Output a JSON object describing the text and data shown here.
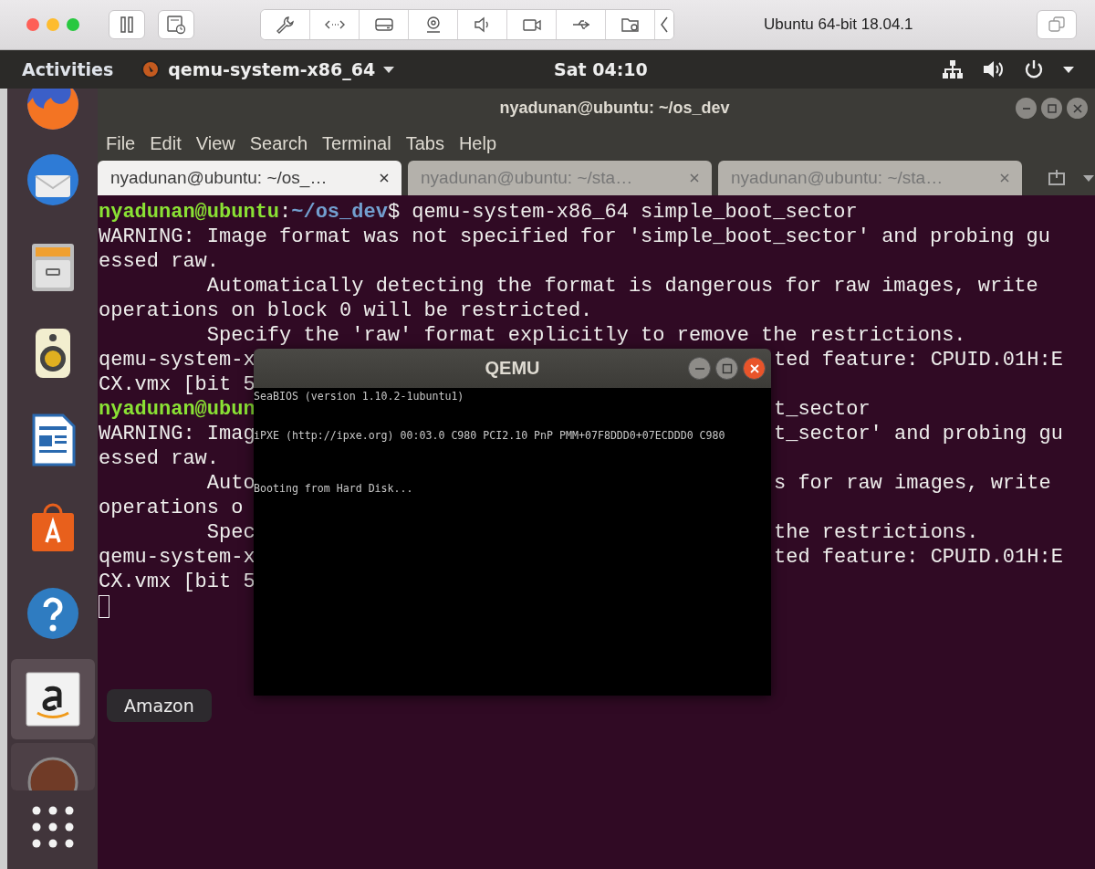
{
  "vm_toolbar": {
    "title": "Ubuntu 64-bit 18.04.1"
  },
  "top_bar": {
    "activities": "Activities",
    "app_menu": "qemu-system-x86_64",
    "clock": "Sat 04:10"
  },
  "dock": {
    "items": [
      {
        "kind": "firefox",
        "highlighted": false
      },
      {
        "kind": "mail",
        "highlighted": false
      },
      {
        "kind": "files",
        "highlighted": false
      },
      {
        "kind": "music",
        "highlighted": false
      },
      {
        "kind": "writer",
        "highlighted": false
      },
      {
        "kind": "software",
        "highlighted": false
      },
      {
        "kind": "help",
        "highlighted": false
      },
      {
        "kind": "amazon",
        "highlighted": true
      },
      {
        "kind": "qemu",
        "highlighted": false
      },
      {
        "kind": "apps",
        "highlighted": false
      }
    ],
    "tooltip": "Amazon"
  },
  "terminal": {
    "title": "nyadunan@ubuntu: ~/os_dev",
    "menu": [
      "File",
      "Edit",
      "View",
      "Search",
      "Terminal",
      "Tabs",
      "Help"
    ],
    "tabs": [
      {
        "label": "nyadunan@ubuntu: ~/os_…",
        "selected": true
      },
      {
        "label": "nyadunan@ubuntu: ~/sta…",
        "selected": false
      },
      {
        "label": "nyadunan@ubuntu: ~/sta…",
        "selected": false
      }
    ],
    "lines": [
      {
        "kind": "prompt",
        "user": "nyadunan@ubuntu",
        "colon": ":",
        "path": "~/os_dev",
        "command": "$ qemu-system-x86_64 simple_boot_sector"
      },
      {
        "kind": "text",
        "left": "WARNING: Image format was not specified for 'simple_boot_sector' and probing gu"
      },
      {
        "kind": "text",
        "left": "essed raw."
      },
      {
        "kind": "text",
        "left": "         Automatically detecting the format is dangerous for raw images, write"
      },
      {
        "kind": "text",
        "left": "operations on block 0 will be restricted."
      },
      {
        "kind": "text",
        "left": "         Specify the 'raw' format explicitly to remove the restrictions."
      },
      {
        "kind": "text",
        "left": "qemu-system-x",
        "right": "ted feature: CPUID.01H:E"
      },
      {
        "kind": "text",
        "left": "CX.vmx [bit 5"
      },
      {
        "kind": "user",
        "left": "nyadunan@ubun",
        "right": "t_sector"
      },
      {
        "kind": "text",
        "left": "WARNING: Imag",
        "right": "t_sector' and probing gu"
      },
      {
        "kind": "text",
        "left": "essed raw."
      },
      {
        "kind": "text",
        "left": "         Auto",
        "right": "s for raw images, write"
      },
      {
        "kind": "text",
        "left": "operations o"
      },
      {
        "kind": "text",
        "left": "         Spec",
        "right": "the restrictions."
      },
      {
        "kind": "text",
        "left": "qemu-system-x",
        "right": "ted feature: CPUID.01H:E"
      },
      {
        "kind": "text",
        "left": "CX.vmx [bit 5"
      },
      {
        "kind": "cursor"
      }
    ]
  },
  "qemu": {
    "title": "QEMU",
    "screen_lines": [
      "SeaBIOS (version 1.10.2-1ubuntu1)",
      "iPXE (http://ipxe.org) 00:03.0 C980 PCI2.10 PnP PMM+07F8DDD0+07ECDDD0 C980",
      "Booting from Hard Disk..."
    ]
  }
}
